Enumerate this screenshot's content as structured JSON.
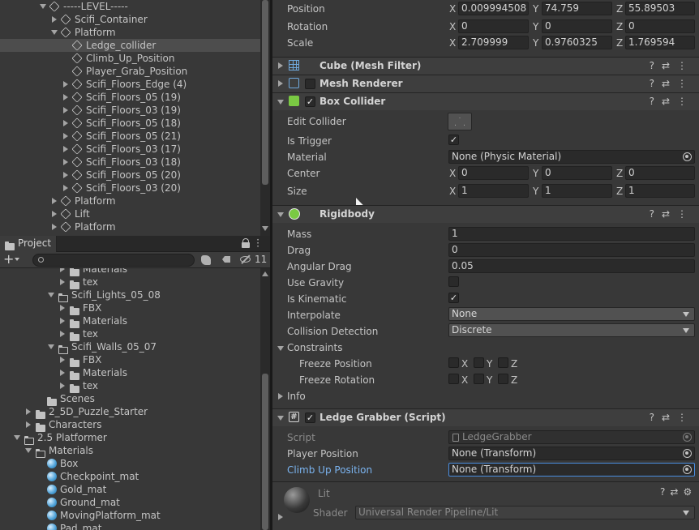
{
  "hierarchy": {
    "items": [
      {
        "label": "-----LEVEL-----",
        "indent": 1,
        "expand": "down"
      },
      {
        "label": "Scifi_Container",
        "indent": 2,
        "expand": "right"
      },
      {
        "label": "Platform",
        "indent": 2,
        "expand": "down"
      },
      {
        "label": "Ledge_collider",
        "indent": 3,
        "expand": "none",
        "selected": true
      },
      {
        "label": "Climb_Up_Position",
        "indent": 3,
        "expand": "none"
      },
      {
        "label": "Player_Grab_Position",
        "indent": 3,
        "expand": "none"
      },
      {
        "label": "Scifi_Floors_Edge (4)",
        "indent": 3,
        "expand": "right"
      },
      {
        "label": "Scifi_Floors_05 (19)",
        "indent": 3,
        "expand": "right"
      },
      {
        "label": "Scifi_Floors_03 (19)",
        "indent": 3,
        "expand": "right"
      },
      {
        "label": "Scifi_Floors_05 (18)",
        "indent": 3,
        "expand": "right"
      },
      {
        "label": "Scifi_Floors_05 (21)",
        "indent": 3,
        "expand": "right"
      },
      {
        "label": "Scifi_Floors_03 (17)",
        "indent": 3,
        "expand": "right"
      },
      {
        "label": "Scifi_Floors_03 (18)",
        "indent": 3,
        "expand": "right"
      },
      {
        "label": "Scifi_Floors_05 (20)",
        "indent": 3,
        "expand": "right"
      },
      {
        "label": "Scifi_Floors_03 (20)",
        "indent": 3,
        "expand": "right"
      },
      {
        "label": "Platform",
        "indent": 2,
        "expand": "right"
      },
      {
        "label": "Lift",
        "indent": 2,
        "expand": "right"
      },
      {
        "label": "Platform",
        "indent": 2,
        "expand": "right"
      }
    ]
  },
  "project": {
    "tab_label": "Project",
    "hidden_count": "11",
    "search_placeholder": "",
    "items": [
      {
        "label": "Materials",
        "indent": 4,
        "type": "folder",
        "expand": "right"
      },
      {
        "label": "tex",
        "indent": 4,
        "type": "folder",
        "expand": "right"
      },
      {
        "label": "Scifi_Lights_05_08",
        "indent": 3,
        "type": "folder-open",
        "expand": "down"
      },
      {
        "label": "FBX",
        "indent": 4,
        "type": "folder",
        "expand": "right"
      },
      {
        "label": "Materials",
        "indent": 4,
        "type": "folder",
        "expand": "right"
      },
      {
        "label": "tex",
        "indent": 4,
        "type": "folder",
        "expand": "right"
      },
      {
        "label": "Scifi_Walls_05_07",
        "indent": 3,
        "type": "folder-open",
        "expand": "down"
      },
      {
        "label": "FBX",
        "indent": 4,
        "type": "folder",
        "expand": "right"
      },
      {
        "label": "Materials",
        "indent": 4,
        "type": "folder",
        "expand": "right"
      },
      {
        "label": "tex",
        "indent": 4,
        "type": "folder",
        "expand": "right"
      },
      {
        "label": "Scenes",
        "indent": 2,
        "type": "folder",
        "expand": "none"
      },
      {
        "label": "2_5D_Puzzle_Starter",
        "indent": 1,
        "type": "folder",
        "expand": "right"
      },
      {
        "label": "Characters",
        "indent": 1,
        "type": "folder",
        "expand": "right"
      },
      {
        "label": "2.5 Platformer",
        "indent": 0,
        "type": "folder-open",
        "expand": "down"
      },
      {
        "label": "Materials",
        "indent": 1,
        "type": "folder-open",
        "expand": "down"
      },
      {
        "label": "Box",
        "indent": 2,
        "type": "mat",
        "expand": "none"
      },
      {
        "label": "Checkpoint_mat",
        "indent": 2,
        "type": "mat",
        "expand": "none"
      },
      {
        "label": "Gold_mat",
        "indent": 2,
        "type": "mat",
        "expand": "none"
      },
      {
        "label": "Ground_mat",
        "indent": 2,
        "type": "mat",
        "expand": "none"
      },
      {
        "label": "MovingPlatform_mat",
        "indent": 2,
        "type": "mat",
        "expand": "none"
      },
      {
        "label": "Pad_mat",
        "indent": 2,
        "type": "mat",
        "expand": "none"
      }
    ]
  },
  "transform": {
    "position": {
      "label": "Position",
      "x": "0.009994508",
      "y": "74.759",
      "z": "55.89503"
    },
    "rotation": {
      "label": "Rotation",
      "x": "0",
      "y": "0",
      "z": "0"
    },
    "scale": {
      "label": "Scale",
      "x": "2.709999",
      "y": "0.9760325",
      "z": "1.769594"
    }
  },
  "axis": {
    "x": "X",
    "y": "Y",
    "z": "Z"
  },
  "components": {
    "mesh_filter": "Cube (Mesh Filter)",
    "mesh_renderer": "Mesh Renderer",
    "box_collider": "Box Collider",
    "rigidbody": "Rigidbody",
    "ledge_grabber": "Ledge Grabber (Script)"
  },
  "box_collider": {
    "edit_label": "Edit Collider",
    "trigger_label": "Is Trigger",
    "is_trigger": true,
    "material_label": "Material",
    "material_value": "None (Physic Material)",
    "center_label": "Center",
    "center": {
      "x": "0",
      "y": "0",
      "z": "0"
    },
    "size_label": "Size",
    "size": {
      "x": "1",
      "y": "1",
      "z": "1"
    }
  },
  "rigidbody": {
    "mass_label": "Mass",
    "mass": "1",
    "drag_label": "Drag",
    "drag": "0",
    "angular_label": "Angular Drag",
    "angular": "0.05",
    "gravity_label": "Use Gravity",
    "use_gravity": false,
    "kinematic_label": "Is Kinematic",
    "is_kinematic": true,
    "interp_label": "Interpolate",
    "interp": "None",
    "collision_label": "Collision Detection",
    "collision": "Discrete",
    "constraints_label": "Constraints",
    "freeze_pos_label": "Freeze Position",
    "freeze_rot_label": "Freeze Rotation",
    "info_label": "Info"
  },
  "ledge_grabber": {
    "script_label": "Script",
    "script_value": "LedgeGrabber",
    "player_label": "Player Position",
    "player_value": "None (Transform)",
    "climb_label": "Climb Up Position",
    "climb_value": "None (Transform)"
  },
  "material": {
    "name": "Lit",
    "shader_label": "Shader",
    "shader_value": "Universal Render Pipeline/Lit"
  },
  "colors": {
    "accent": "#7bb4f0",
    "selected_row": "#4d4d4d",
    "panel": "#383838",
    "field": "#2a2a2a"
  }
}
